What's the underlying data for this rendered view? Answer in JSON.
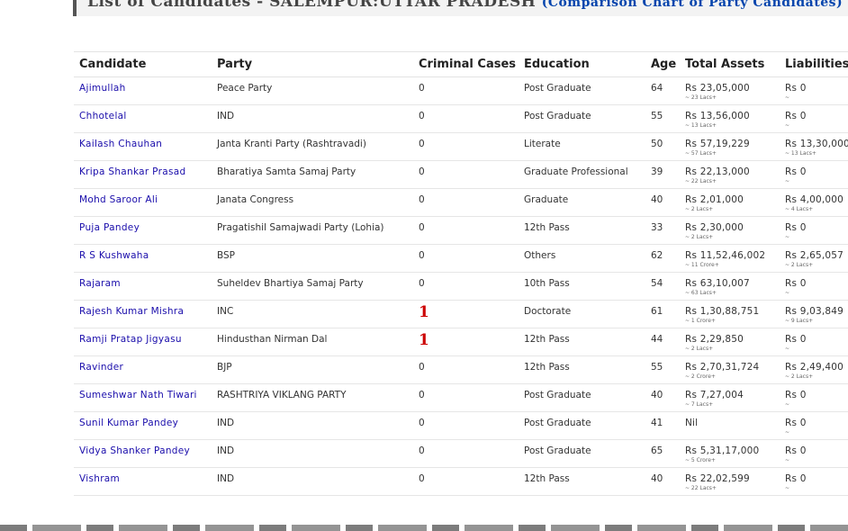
{
  "header": {
    "title": "List of Candidates - SALEMPUR:UTTAR PRADESH",
    "link": "(Comparison Chart of Party Candidates)"
  },
  "columns": [
    "Candidate",
    "Party",
    "Criminal Cases",
    "Education",
    "Age",
    "Total Assets",
    "Liabilities"
  ],
  "rows": [
    {
      "name": "Ajimullah",
      "party": "Peace Party",
      "criminal": "0",
      "education": "Post Graduate",
      "age": "64",
      "assets": "Rs 23,05,000",
      "assets_sub": "~ 23 Lacs+",
      "liab": "Rs 0",
      "liab_sub": "~"
    },
    {
      "name": "Chhotelal",
      "party": "IND",
      "criminal": "0",
      "education": "Post Graduate",
      "age": "55",
      "assets": "Rs 13,56,000",
      "assets_sub": "~ 13 Lacs+",
      "liab": "Rs 0",
      "liab_sub": "~"
    },
    {
      "name": "Kailash Chauhan",
      "party": "Janta Kranti Party (Rashtravadi)",
      "criminal": "0",
      "education": "Literate",
      "age": "50",
      "assets": "Rs 57,19,229",
      "assets_sub": "~ 57 Lacs+",
      "liab": "Rs 13,30,000",
      "liab_sub": "~ 13 Lacs+"
    },
    {
      "name": "Kripa Shankar Prasad",
      "party": "Bharatiya Samta Samaj Party",
      "criminal": "0",
      "education": "Graduate Professional",
      "age": "39",
      "assets": "Rs 22,13,000",
      "assets_sub": "~ 22 Lacs+",
      "liab": "Rs 0",
      "liab_sub": "~"
    },
    {
      "name": "Mohd Saroor Ali",
      "party": "Janata Congress",
      "criminal": "0",
      "education": "Graduate",
      "age": "40",
      "assets": "Rs 2,01,000",
      "assets_sub": "~ 2 Lacs+",
      "liab": "Rs 4,00,000",
      "liab_sub": "~ 4 Lacs+"
    },
    {
      "name": "Puja Pandey",
      "party": "Pragatishil Samajwadi Party (Lohia)",
      "criminal": "0",
      "education": "12th Pass",
      "age": "33",
      "assets": "Rs 2,30,000",
      "assets_sub": "~ 2 Lacs+",
      "liab": "Rs 0",
      "liab_sub": "~"
    },
    {
      "name": "R S Kushwaha",
      "party": "BSP",
      "criminal": "0",
      "education": "Others",
      "age": "62",
      "assets": "Rs 11,52,46,002",
      "assets_sub": "~ 11 Crore+",
      "liab": "Rs 2,65,057",
      "liab_sub": "~ 2 Lacs+"
    },
    {
      "name": "Rajaram",
      "party": "Suheldev Bhartiya Samaj Party",
      "criminal": "0",
      "education": "10th Pass",
      "age": "54",
      "assets": "Rs 63,10,007",
      "assets_sub": "~ 63 Lacs+",
      "liab": "Rs 0",
      "liab_sub": "~"
    },
    {
      "name": "Rajesh Kumar Mishra",
      "party": "INC",
      "criminal": "1",
      "education": "Doctorate",
      "age": "61",
      "assets": "Rs 1,30,88,751",
      "assets_sub": "~ 1 Crore+",
      "liab": "Rs 9,03,849",
      "liab_sub": "~ 9 Lacs+"
    },
    {
      "name": "Ramji Pratap Jigyasu",
      "party": "Hindusthan Nirman Dal",
      "criminal": "1",
      "education": "12th Pass",
      "age": "44",
      "assets": "Rs 2,29,850",
      "assets_sub": "~ 2 Lacs+",
      "liab": "Rs 0",
      "liab_sub": "~"
    },
    {
      "name": "Ravinder",
      "party": "BJP",
      "criminal": "0",
      "education": "12th Pass",
      "age": "55",
      "assets": "Rs 2,70,31,724",
      "assets_sub": "~ 2 Crore+",
      "liab": "Rs 2,49,400",
      "liab_sub": "~ 2 Lacs+"
    },
    {
      "name": "Sumeshwar Nath Tiwari",
      "party": "RASHTRIYA VIKLANG PARTY",
      "criminal": "0",
      "education": "Post Graduate",
      "age": "40",
      "assets": "Rs 7,27,004",
      "assets_sub": "~ 7 Lacs+",
      "liab": "Rs 0",
      "liab_sub": "~"
    },
    {
      "name": "Sunil Kumar Pandey",
      "party": "IND",
      "criminal": "0",
      "education": "Post Graduate",
      "age": "41",
      "assets": "Nil",
      "assets_sub": "",
      "liab": "Rs 0",
      "liab_sub": "~"
    },
    {
      "name": "Vidya Shanker Pandey",
      "party": "IND",
      "criminal": "0",
      "education": "Post Graduate",
      "age": "65",
      "assets": "Rs 5,31,17,000",
      "assets_sub": "~ 5 Crore+",
      "liab": "Rs 0",
      "liab_sub": "~"
    },
    {
      "name": "Vishram",
      "party": "IND",
      "criminal": "0",
      "education": "12th Pass",
      "age": "40",
      "assets": "Rs 22,02,599",
      "assets_sub": "~ 22 Lacs+",
      "liab": "Rs 0",
      "liab_sub": "~"
    }
  ]
}
